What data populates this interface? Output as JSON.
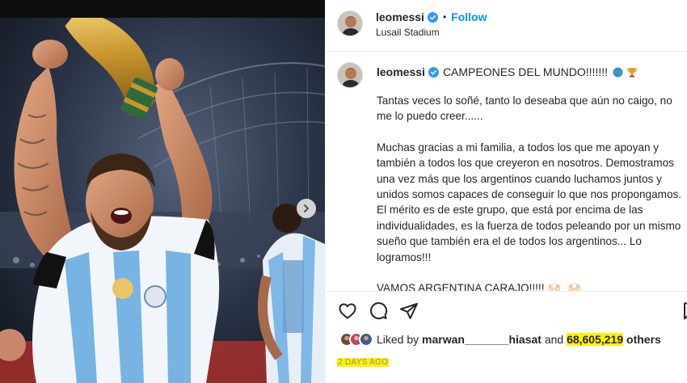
{
  "header": {
    "username": "leomessi",
    "follow_label": "Follow",
    "location": "Lusail Stadium",
    "separator": "•"
  },
  "caption": {
    "username": "leomessi",
    "title": "CAMPEONES DEL MUNDO!!!!!!!",
    "paragraphs": [
      "Tantas veces lo soñé, tanto lo deseaba que aún no caigo, no me lo puedo creer......",
      "Muchas gracias a mi familia, a todos los que me apoyan y también a todos los que creyeron en nosotros. Demostramos una vez más que los argentinos cuando luchamos juntos y unidos somos capaces de conseguir lo que nos propongamos. El mérito es de este grupo, que está por encima de las individualidades, es la fuerza de todos peleando por un mismo sueño que también era el de todos los argentinos... Lo logramos!!!"
    ],
    "closing": "VAMOS ARGENTINA CARAJO!!!!!",
    "closing_emoji": "🙌🏻 🙌🏻",
    "icons": [
      "globe-icon",
      "trophy-icon"
    ]
  },
  "likes": {
    "prefix": "Liked by",
    "user": "marwan_______hiasat",
    "and": "and",
    "count": "68,605,219",
    "suffix": "others"
  },
  "timestamp": "2 DAYS AGO",
  "icons": {
    "actions": [
      "heart-icon",
      "comment-icon",
      "share-icon",
      "bookmark-icon"
    ],
    "photo": [
      "chevron-right-icon"
    ]
  },
  "colors": {
    "accent": "#0095f6",
    "verified": "#3897f0",
    "highlight": "#fff200",
    "text": "#262626",
    "muted": "#8e8e8e"
  }
}
